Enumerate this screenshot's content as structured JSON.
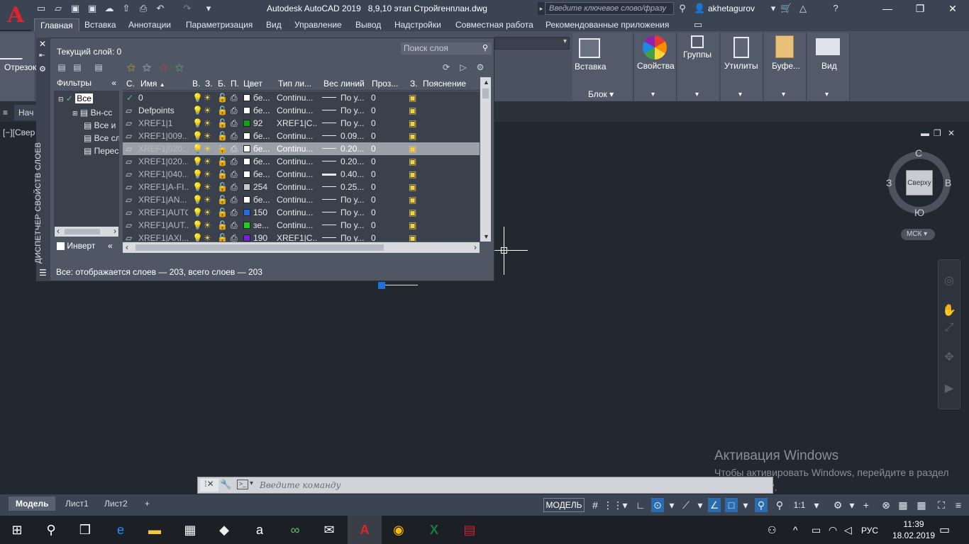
{
  "window": {
    "app": "Autodesk AutoCAD 2019",
    "file": "8,9,10 этап Стройгенплан.dwg",
    "search_placeholder": "Введите ключевое слово/фразу",
    "user": "akhetagurov"
  },
  "ribbon_tabs": [
    "Главная",
    "Вставка",
    "Аннотации",
    "Параметризация",
    "Вид",
    "Управление",
    "Вывод",
    "Надстройки",
    "Совместная работа",
    "Рекомендованные приложения"
  ],
  "ribbon": {
    "line_tool": "Отрезок",
    "insert": "Вставка",
    "block_panel": "Блок",
    "properties": "Свойства",
    "groups": "Группы",
    "utilities": "Утилиты",
    "clipboard": "Буфе...",
    "view": "Вид"
  },
  "doc_tab": "Нач",
  "viewport": {
    "label": "[−][Свер",
    "viewcube_face": "Сверху",
    "north": "С",
    "south": "Ю",
    "east": "В",
    "west": "З",
    "ucs": "МСК"
  },
  "layer_palette": {
    "vertical_title": "ДИСПЕТЧЕР СВОЙСТВ СЛОЕВ",
    "current_layer": "Текущий слой: 0",
    "search_placeholder": "Поиск слоя",
    "filters_label": "Фильтры",
    "filters": [
      {
        "label": "Все",
        "level": 0
      },
      {
        "label": "Вн-сс",
        "level": 1
      },
      {
        "label": "Все и",
        "level": 2
      },
      {
        "label": "Все сл",
        "level": 2
      },
      {
        "label": "Перес",
        "level": 2
      }
    ],
    "invert_label": "Инверт",
    "columns": [
      "С.",
      "Имя",
      "В.",
      "З.",
      "Б.",
      "П.",
      "Цвет",
      "Тип ли...",
      "Вес линий",
      "Проз...",
      "З.",
      "Пояснение"
    ],
    "rows": [
      {
        "name": "0",
        "color_name": "бе...",
        "swatch": "#ffffff",
        "linetype": "Continu...",
        "lw": "По у...",
        "transp": "0",
        "current": true
      },
      {
        "name": "Defpoints",
        "color_name": "бе...",
        "swatch": "#ffffff",
        "linetype": "Continu...",
        "lw": "По у...",
        "transp": "0"
      },
      {
        "name": "XREF1|1",
        "color_name": "92",
        "swatch": "#14a014",
        "linetype": "XREF1|C...",
        "lw": "По у...",
        "transp": "0"
      },
      {
        "name": "XREF1|009...",
        "color_name": "бе...",
        "swatch": "#ffffff",
        "linetype": "Continu...",
        "lw": "0.09...",
        "transp": "0"
      },
      {
        "name": "XREF1|020...",
        "color_name": "бе...",
        "swatch": "#ffffff",
        "linetype": "Continu...",
        "lw": "0.20...",
        "transp": "0",
        "selected": true
      },
      {
        "name": "XREF1|020...",
        "color_name": "бе...",
        "swatch": "#ffffff",
        "linetype": "Continu...",
        "lw": "0.20...",
        "transp": "0"
      },
      {
        "name": "XREF1|040...",
        "color_name": "бе...",
        "swatch": "#ffffff",
        "linetype": "Continu...",
        "lw": "0.40...",
        "transp": "0"
      },
      {
        "name": "XREF1|A-FI...",
        "color_name": "254",
        "swatch": "#c8c8c8",
        "linetype": "Continu...",
        "lw": "0.25...",
        "transp": "0"
      },
      {
        "name": "XREF1|AN...",
        "color_name": "бе...",
        "swatch": "#ffffff",
        "linetype": "Continu...",
        "lw": "По у...",
        "transp": "0"
      },
      {
        "name": "XREF1|AUTO",
        "color_name": "150",
        "swatch": "#1e6fe0",
        "linetype": "Continu...",
        "lw": "По у...",
        "transp": "0"
      },
      {
        "name": "XREF1|AUT...",
        "color_name": "зе...",
        "swatch": "#22cc22",
        "linetype": "Continu...",
        "lw": "По у...",
        "transp": "0"
      },
      {
        "name": "XREF1|AXI...",
        "color_name": "190",
        "swatch": "#7a1ee0",
        "linetype": "XREF1|C...",
        "lw": "По у...",
        "transp": "0"
      }
    ],
    "status": "Все: отображается слоев — 203, всего слоев — 203"
  },
  "watermark": {
    "title": "Активация Windows",
    "body": "Чтобы активировать Windows, перейдите в раздел \"Параметры\"."
  },
  "command": {
    "placeholder": "Введите команду"
  },
  "layout_tabs": [
    "Модель",
    "Лист1",
    "Лист2"
  ],
  "status": {
    "model": "МОДЕЛЬ",
    "scale": "1:1"
  },
  "taskbar": {
    "lang": "РУС",
    "time": "11:39",
    "date": "18.02.2019"
  }
}
